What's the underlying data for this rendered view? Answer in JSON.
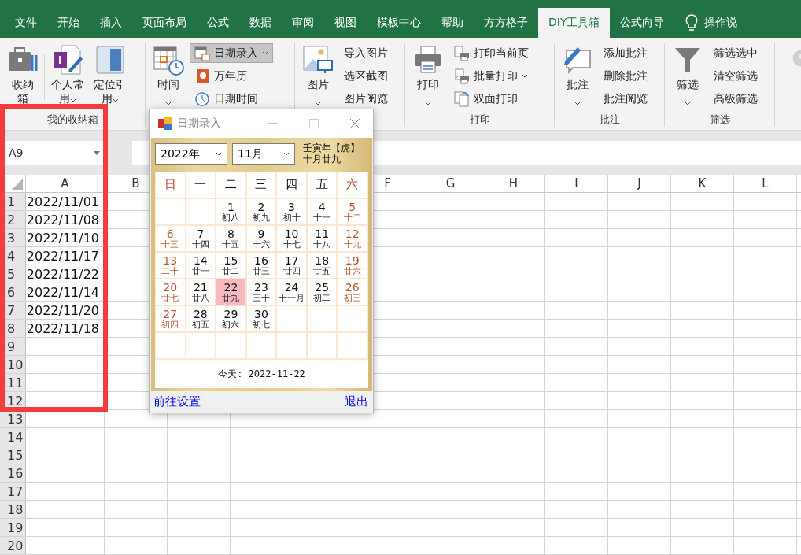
{
  "tabs": [
    {
      "label": "文件",
      "selected": false
    },
    {
      "label": "开始",
      "selected": false
    },
    {
      "label": "插入",
      "selected": false
    },
    {
      "label": "页面布局",
      "selected": false
    },
    {
      "label": "公式",
      "selected": false
    },
    {
      "label": "数据",
      "selected": false
    },
    {
      "label": "审阅",
      "selected": false
    },
    {
      "label": "视图",
      "selected": false
    },
    {
      "label": "模板中心",
      "selected": false
    },
    {
      "label": "帮助",
      "selected": false
    },
    {
      "label": "方方格子",
      "selected": false
    },
    {
      "label": "DIY工具箱",
      "selected": true
    },
    {
      "label": "公式向导",
      "selected": false
    }
  ],
  "tell_me": {
    "label": "操作说"
  },
  "ribbon": {
    "groups": [
      {
        "kind": "storage",
        "label": "我的收纳箱",
        "large": [
          {
            "label": "收纳箱",
            "dropdown": false
          },
          {
            "label": "个人常用",
            "dropdown": true
          },
          {
            "label": "定位引用",
            "dropdown": true
          }
        ]
      },
      {
        "kind": "datetime",
        "large": [
          {
            "label": "时间",
            "dropdown": true
          }
        ],
        "small": [
          {
            "label": "日期录入",
            "dropdown": true,
            "pressed": true
          },
          {
            "label": "万年历",
            "dropdown": false,
            "pressed": false
          },
          {
            "label": "日期时间",
            "dropdown": false,
            "pressed": false
          }
        ]
      },
      {
        "kind": "picture",
        "large": [
          {
            "label": "图片",
            "dropdown": true
          }
        ],
        "small": [
          {
            "label": "导入图片",
            "dropdown": false,
            "pressed": false
          },
          {
            "label": "选区截图",
            "dropdown": false,
            "pressed": false
          },
          {
            "label": "图片阅览",
            "dropdown": false,
            "pressed": false
          }
        ]
      },
      {
        "kind": "print",
        "label": "打印",
        "large": [
          {
            "label": "打印",
            "dropdown": true
          }
        ],
        "small": [
          {
            "label": "打印当前页",
            "dropdown": false,
            "pressed": false
          },
          {
            "label": "批量打印",
            "dropdown": true,
            "pressed": false
          },
          {
            "label": "双面打印",
            "dropdown": false,
            "pressed": false
          }
        ]
      },
      {
        "kind": "comment",
        "label": "批注",
        "large": [
          {
            "label": "批注",
            "dropdown": true
          }
        ],
        "small": [
          {
            "label": "添加批注",
            "dropdown": false,
            "pressed": false
          },
          {
            "label": "删除批注",
            "dropdown": false,
            "pressed": false
          },
          {
            "label": "批注阅览",
            "dropdown": false,
            "pressed": false
          }
        ]
      },
      {
        "kind": "filter",
        "label": "筛选",
        "large": [
          {
            "label": "筛选",
            "dropdown": true
          }
        ],
        "small": [
          {
            "label": "筛选选中",
            "dropdown": false,
            "pressed": false
          },
          {
            "label": "清空筛选",
            "dropdown": false,
            "pressed": false
          },
          {
            "label": "高级筛选",
            "dropdown": false,
            "pressed": false
          }
        ]
      }
    ]
  },
  "name_box": {
    "value": "A9"
  },
  "sheet": {
    "column_headers": [
      "A",
      "B",
      "F",
      "G",
      "H",
      "I",
      "J",
      "K",
      "L"
    ],
    "rows": [
      {
        "label": "1",
        "a": "2022/11/01"
      },
      {
        "label": "2",
        "a": "2022/11/08"
      },
      {
        "label": "3",
        "a": "2022/11/10"
      },
      {
        "label": "4",
        "a": "2022/11/17"
      },
      {
        "label": "5",
        "a": "2022/11/22"
      },
      {
        "label": "6",
        "a": "2022/11/14"
      },
      {
        "label": "7",
        "a": "2022/11/20"
      },
      {
        "label": "8",
        "a": "2022/11/18"
      },
      {
        "label": "9"
      },
      {
        "label": "10"
      },
      {
        "label": "11"
      },
      {
        "label": "12"
      },
      {
        "label": "13"
      },
      {
        "label": "14"
      },
      {
        "label": "15"
      },
      {
        "label": "16"
      },
      {
        "label": "17"
      },
      {
        "label": "18"
      },
      {
        "label": "19"
      },
      {
        "label": "20"
      }
    ]
  },
  "dialog": {
    "title": "日期录入",
    "year": "2022年",
    "month": "11月",
    "lunar_year": "壬寅年【虎】",
    "lunar_date": "十月廿九",
    "weekdays": [
      "日",
      "一",
      "二",
      "三",
      "四",
      "五",
      "六"
    ],
    "weeks": [
      [
        {
          "kind": "blank"
        },
        {
          "kind": "blank"
        },
        {
          "kind": "day",
          "day": "1",
          "lunar": "初八",
          "selected": false
        },
        {
          "kind": "day",
          "day": "2",
          "lunar": "初九",
          "selected": false
        },
        {
          "kind": "day",
          "day": "3",
          "lunar": "初十",
          "selected": false
        },
        {
          "kind": "day",
          "day": "4",
          "lunar": "十一",
          "selected": false
        },
        {
          "kind": "day",
          "day": "5",
          "lunar": "十二",
          "selected": false
        }
      ],
      [
        {
          "kind": "day",
          "day": "6",
          "lunar": "十三",
          "selected": false
        },
        {
          "kind": "day",
          "day": "7",
          "lunar": "十四",
          "selected": false
        },
        {
          "kind": "day",
          "day": "8",
          "lunar": "十五",
          "selected": false
        },
        {
          "kind": "day",
          "day": "9",
          "lunar": "十六",
          "selected": false
        },
        {
          "kind": "day",
          "day": "10",
          "lunar": "十七",
          "selected": false
        },
        {
          "kind": "day",
          "day": "11",
          "lunar": "十八",
          "selected": false
        },
        {
          "kind": "day",
          "day": "12",
          "lunar": "十九",
          "selected": false
        }
      ],
      [
        {
          "kind": "day",
          "day": "13",
          "lunar": "二十",
          "selected": false
        },
        {
          "kind": "day",
          "day": "14",
          "lunar": "廿一",
          "selected": false
        },
        {
          "kind": "day",
          "day": "15",
          "lunar": "廿二",
          "selected": false
        },
        {
          "kind": "day",
          "day": "16",
          "lunar": "廿三",
          "selected": false
        },
        {
          "kind": "day",
          "day": "17",
          "lunar": "廿四",
          "selected": false
        },
        {
          "kind": "day",
          "day": "18",
          "lunar": "廿五",
          "selected": false
        },
        {
          "kind": "day",
          "day": "19",
          "lunar": "廿六",
          "selected": false
        }
      ],
      [
        {
          "kind": "day",
          "day": "20",
          "lunar": "廿七",
          "selected": false
        },
        {
          "kind": "day",
          "day": "21",
          "lunar": "廿八",
          "selected": false
        },
        {
          "kind": "day",
          "day": "22",
          "lunar": "廿九",
          "selected": true
        },
        {
          "kind": "day",
          "day": "23",
          "lunar": "三十",
          "selected": false
        },
        {
          "kind": "day",
          "day": "24",
          "lunar": "十一月",
          "selected": false
        },
        {
          "kind": "day",
          "day": "25",
          "lunar": "初二",
          "selected": false
        },
        {
          "kind": "day",
          "day": "26",
          "lunar": "初三",
          "selected": false
        }
      ],
      [
        {
          "kind": "day",
          "day": "27",
          "lunar": "初四",
          "selected": false
        },
        {
          "kind": "day",
          "day": "28",
          "lunar": "初五",
          "selected": false
        },
        {
          "kind": "day",
          "day": "29",
          "lunar": "初六",
          "selected": false
        },
        {
          "kind": "day",
          "day": "30",
          "lunar": "初七",
          "selected": false
        },
        {
          "kind": "blank"
        },
        {
          "kind": "blank"
        },
        {
          "kind": "blank"
        }
      ],
      [
        {
          "kind": "blank"
        },
        {
          "kind": "blank"
        },
        {
          "kind": "blank"
        },
        {
          "kind": "blank"
        },
        {
          "kind": "blank"
        },
        {
          "kind": "blank"
        },
        {
          "kind": "blank"
        }
      ]
    ],
    "today": "今天: 2022-11-22",
    "links": [
      "前往设置",
      "退出"
    ]
  }
}
